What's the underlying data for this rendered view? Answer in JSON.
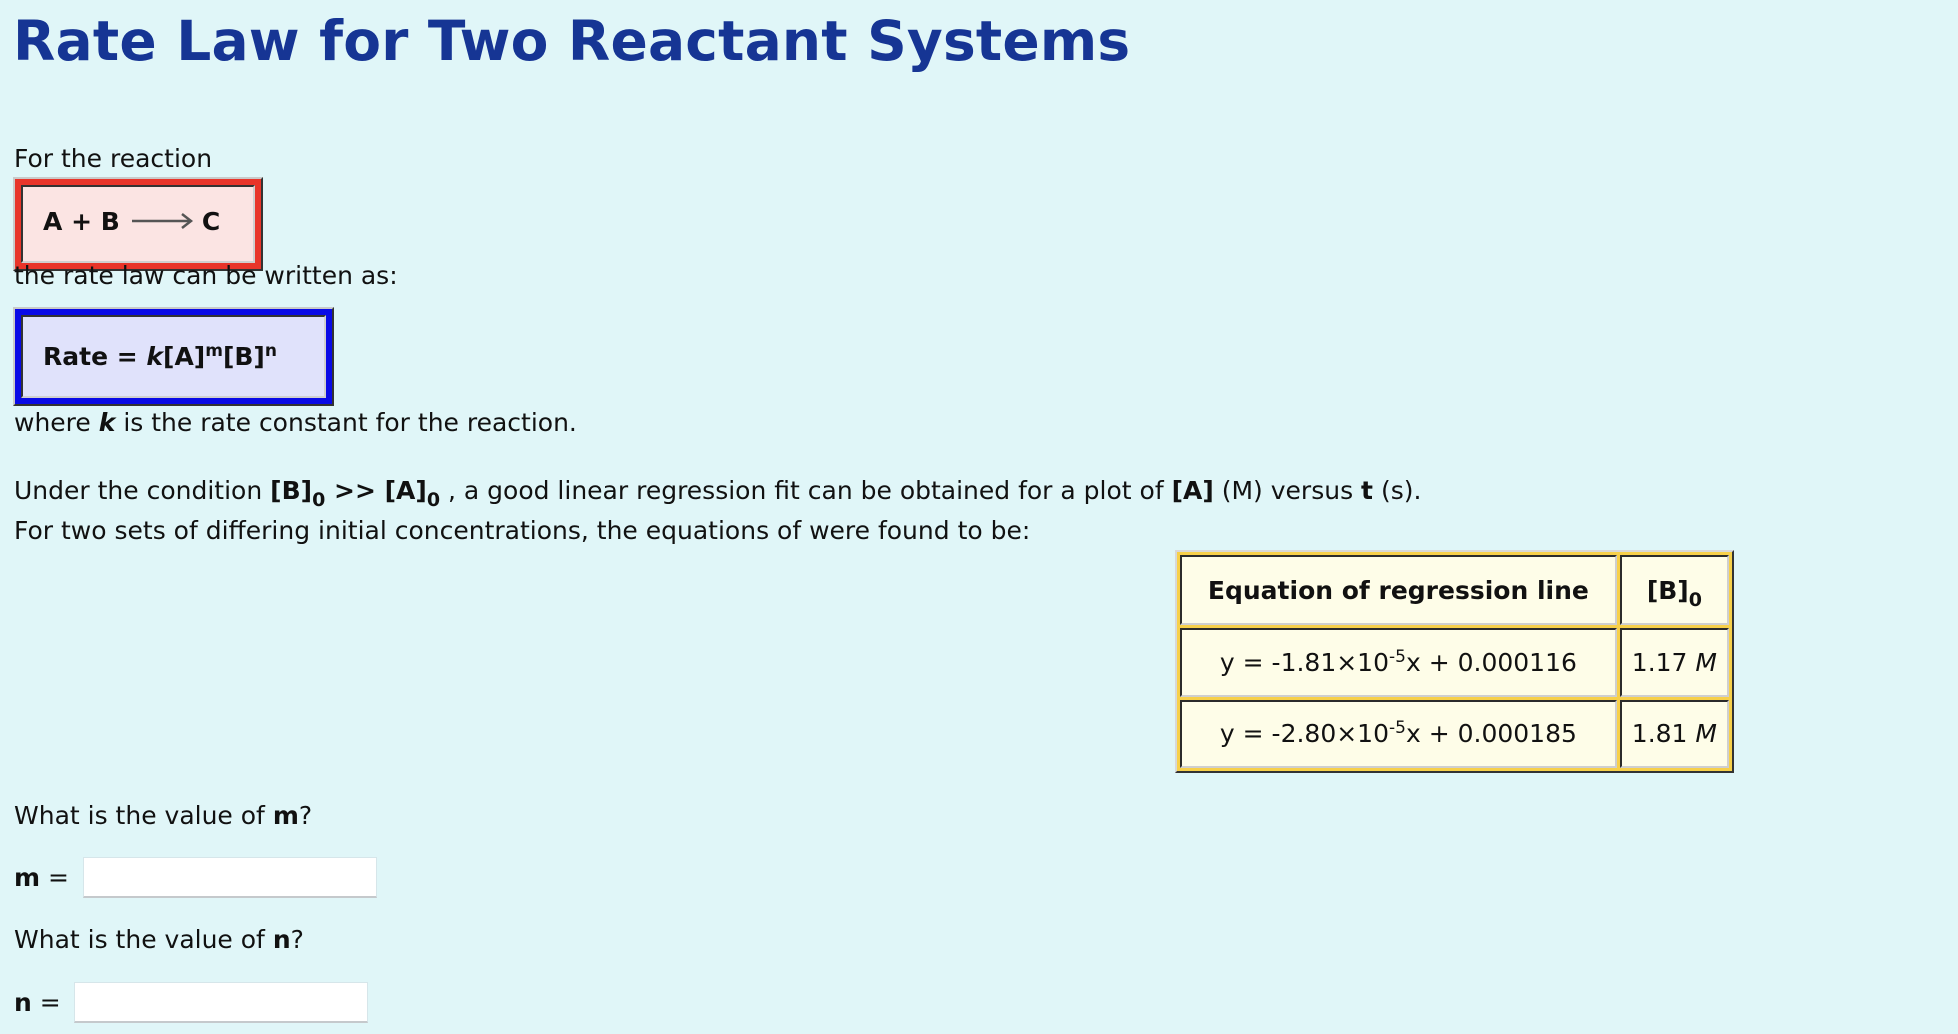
{
  "title": "Rate Law for Two Reactant Systems",
  "intro": {
    "for_reaction": "For the reaction",
    "rate_law_intro": "the rate law can be written as:"
  },
  "reaction": {
    "reactant_a": "A",
    "plus": "+",
    "reactant_b": "B",
    "product": "C",
    "arrow_icon": "right-arrow"
  },
  "rate_law": {
    "prefix": "Rate = ",
    "k": "k",
    "a": "[A]",
    "m": "m",
    "b": "[B]",
    "n": "n"
  },
  "where_line": {
    "before": "where ",
    "k": "k",
    "after": " is the rate constant for the reaction."
  },
  "condition_line": {
    "before": "Under the condition ",
    "b0": "[B]",
    "sub0": "0",
    "gg": " >> ",
    "a0": "[A]",
    "sub1": "0",
    "middle": " , a good linear regression fit can be obtained for a plot of ",
    "a": "[A]",
    "unit_m": " (M) versus ",
    "t": "t",
    "unit_s": " (s)."
  },
  "sets_line": "For two sets of differing initial concentrations, the equations of were found to be:",
  "table": {
    "headers": {
      "equation": "Equation of regression line",
      "b0": "[B]",
      "b0_sub": "0"
    },
    "rows": [
      {
        "eq_prefix": "y = -1.81×10",
        "eq_exp": "-5",
        "eq_suffix": "x + 0.000116",
        "b0_value": "1.17",
        "b0_unit": "M"
      },
      {
        "eq_prefix": "y = -2.80×10",
        "eq_exp": "-5",
        "eq_suffix": "x + 0.000185",
        "b0_value": "1.81",
        "b0_unit": "M"
      }
    ]
  },
  "questions": {
    "m": {
      "q_before": "What is the value of ",
      "var": "m",
      "q_after": "?",
      "label": "m",
      "eq": " = ",
      "value": "",
      "placeholder": ""
    },
    "n": {
      "q_before": "What is the value of ",
      "var": "n",
      "q_after": "?",
      "label": "n",
      "eq": " = ",
      "value": "",
      "placeholder": ""
    }
  }
}
